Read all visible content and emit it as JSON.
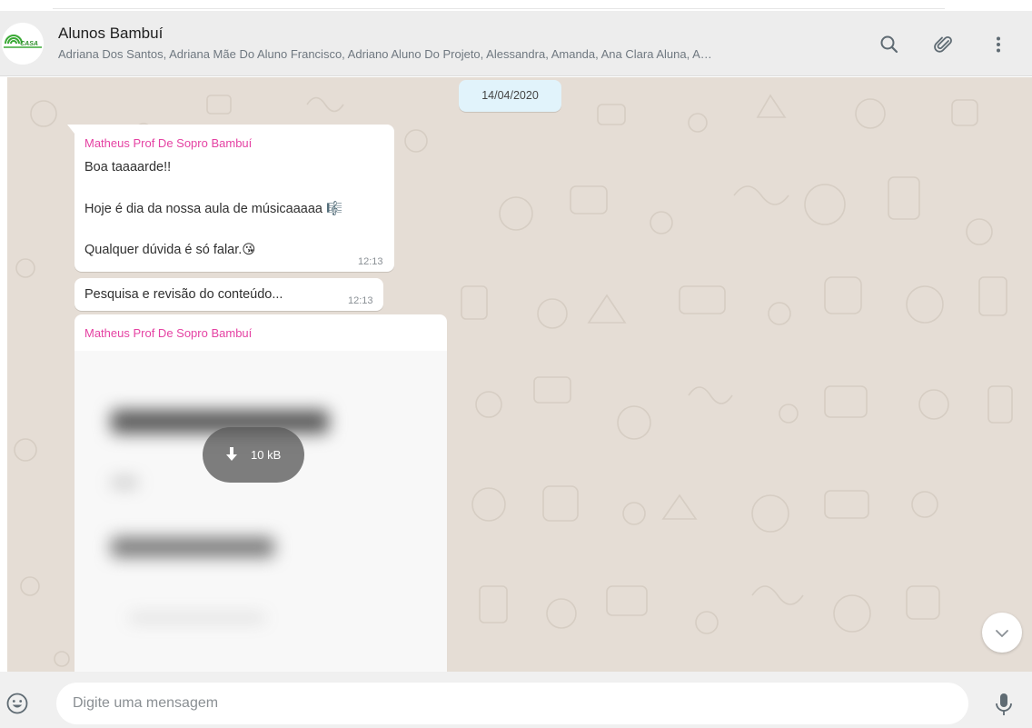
{
  "header": {
    "title": "Alunos Bambuí",
    "members": "Adriana Dos Santos, Adriana Mãe Do Aluno Francisco, Adriano Aluno Do Projeto, Alessandra, Amanda, Ana Clara Aluna, A…",
    "avatar_text": "CASA",
    "icons": [
      "search-icon",
      "attach-icon",
      "menu-icon"
    ]
  },
  "chat": {
    "date_label": "14/04/2020",
    "messages": [
      {
        "sender": "Matheus Prof De Sopro Bambuí",
        "lines": [
          "Boa taaaarde!!",
          "Hoje é dia da nossa aula de músicaaaaa 🎼",
          "Qualquer dúvida é só falar.😘"
        ],
        "time": "12:13"
      },
      {
        "text": "Pesquisa e revisão do conteúdo...",
        "time": "12:13"
      },
      {
        "sender": "Matheus Prof De Sopro Bambuí",
        "attachment": {
          "download_size": "10 kB",
          "icon": "download-icon"
        }
      }
    ]
  },
  "footer": {
    "input_placeholder": "Digite uma mensagem",
    "icons": [
      "emoji-icon",
      "mic-icon"
    ]
  },
  "colors": {
    "header_bg": "#ededed",
    "chat_bg": "#e5ddd5",
    "sender_name": "#e542a3",
    "date_pill": "#e1f3fb",
    "footer_bg": "#f0f0f0"
  }
}
